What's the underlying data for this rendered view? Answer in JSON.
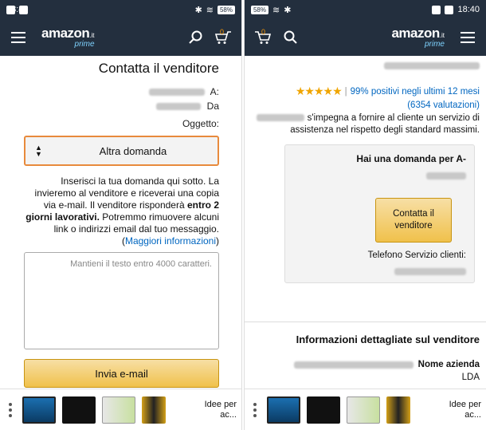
{
  "status_bar": {
    "battery": "58%",
    "time": "18:40"
  },
  "navbar": {
    "brand": "amazon",
    "tld": ".it",
    "prime": "prime",
    "cart_count": "0"
  },
  "left_page": {
    "title": "Contatta il venditore",
    "to_label": "A:",
    "from_label": "Da",
    "subject_label": "Oggetto:",
    "subject_value": "Altra domanda",
    "info_part1": "Inserisci la tua domanda qui sotto. La invieremo al venditore e riceverai una copia via e-mail. Il venditore risponderà ",
    "info_bold1": "entro 2 giorni lavorativi.",
    "info_part2": " Potremmo rimuovere alcuni link o indirizzi email dal tuo messaggio. (",
    "info_link": "Maggiori informazioni",
    "info_part3": ")",
    "textarea_placeholder": "Mantieni il testo entro 4000 caratteri.",
    "send_button": "Invia e-mail"
  },
  "right_page": {
    "stars": "★★★★★",
    "rating_positive": "99% positivi negli ultimi 12 mesi",
    "rating_sep": "|",
    "reviews": "(6354 valutazioni)",
    "commit_text": "s'impegna a fornire al cliente un servizio di assistenza nel rispetto degli standard massimi.",
    "help_title": "Hai una domanda per A-",
    "contact_button": "Contatta il venditore",
    "phone_label": "Telefono Servizio clienti:",
    "section_title": "Informazioni dettagliate sul venditore",
    "company_label": "Nome azienda",
    "company_line2": "LDA"
  },
  "recommendations": {
    "label": "Idee per ac...",
    "items": [
      "tv",
      "ssd",
      "tablet",
      "batteries"
    ]
  },
  "colors": {
    "header_bg": "#232f3e",
    "accent_orange": "#f90",
    "button_yellow": "#f0c14b",
    "link_blue": "#0066c0",
    "star_gold": "#f0a500"
  }
}
